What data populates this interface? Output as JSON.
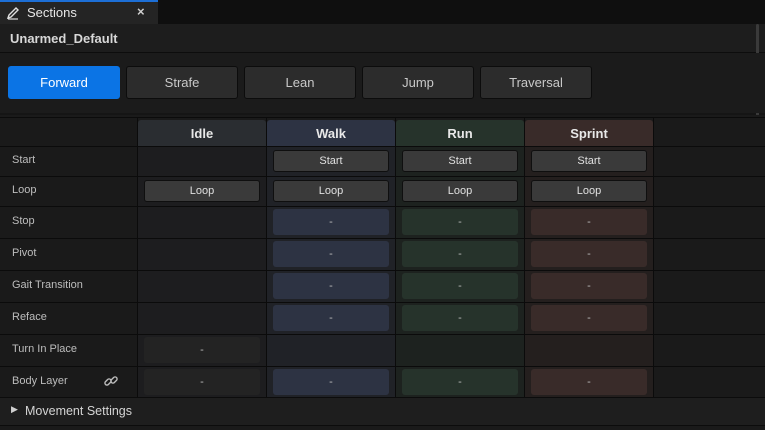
{
  "tab": {
    "title": "Sections",
    "close": "×",
    "icon": "pencil-icon"
  },
  "header": {
    "asset_name": "Unarmed_Default"
  },
  "directions": [
    {
      "label": "Forward",
      "active": true
    },
    {
      "label": "Strafe",
      "active": false
    },
    {
      "label": "Lean",
      "active": false
    },
    {
      "label": "Jump",
      "active": false
    },
    {
      "label": "Traversal",
      "active": false
    }
  ],
  "grid": {
    "columns": [
      {
        "label": "Idle",
        "color": "#2a2d31"
      },
      {
        "label": "Walk",
        "color": "#2d3343"
      },
      {
        "label": "Run",
        "color": "#26332b"
      },
      {
        "label": "Sprint",
        "color": "#392b29"
      }
    ],
    "rows": [
      {
        "label": "Start",
        "cells": [
          "",
          "Start",
          "Start",
          "Start"
        ]
      },
      {
        "label": "Loop",
        "cells": [
          "Loop",
          "Loop",
          "Loop",
          "Loop"
        ]
      },
      {
        "label": "Stop",
        "cells": [
          "",
          "-",
          "-",
          "-"
        ]
      },
      {
        "label": "Pivot",
        "cells": [
          "",
          "-",
          "-",
          "-"
        ]
      },
      {
        "label": "Gait Transition",
        "cells": [
          "",
          "-",
          "-",
          "-"
        ]
      },
      {
        "label": "Reface",
        "cells": [
          "",
          "-",
          "-",
          "-"
        ]
      },
      {
        "label": "Turn In Place",
        "cells": [
          "-",
          "",
          "",
          ""
        ]
      },
      {
        "label": "Body Layer",
        "cells": [
          "-",
          "-",
          "-",
          "-"
        ]
      }
    ]
  },
  "body_layer_icon": "link-icon",
  "settings": {
    "label": "Movement Settings",
    "arrow": "▶"
  },
  "colors": {
    "accent": "#0b74e5"
  }
}
